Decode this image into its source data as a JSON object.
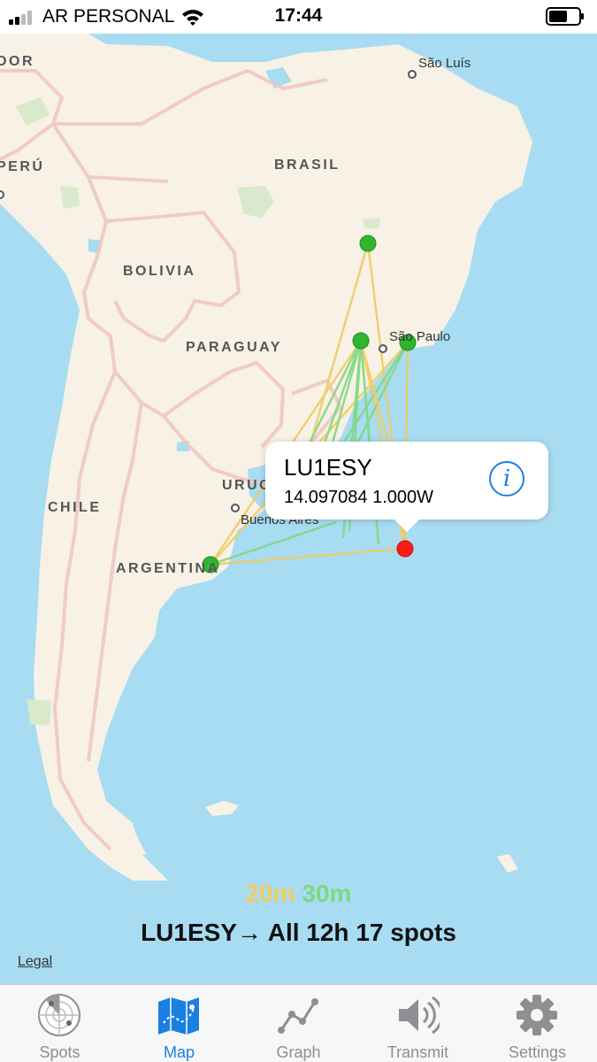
{
  "status_bar": {
    "carrier": "AR PERSONAL",
    "time": "17:44"
  },
  "map": {
    "country_labels": {
      "ecuador_partial": "DOR",
      "peru": "PERÚ",
      "brasil": "BRASIL",
      "bolivia": "BOLIVIA",
      "paraguay": "PARAGUAY",
      "uruguay_partial": "URUG",
      "chile": "CHILE",
      "argentina": "ARGENTINA"
    },
    "city_labels": {
      "sao_luis": "São Luís",
      "sao_paulo": "São Paulo",
      "buenos_aires": "Buenos Aires"
    },
    "spot_colors": {
      "receiver": "#2fb52f",
      "transmitter": "#ff1a1a",
      "band_20m": "#f0cc5e",
      "band_30m": "#7fd87f"
    },
    "callout": {
      "callsign": "LU1ESY",
      "detail": "14.097084 1.000W",
      "info_icon": "info-icon"
    },
    "legal": "Legal"
  },
  "legend": {
    "band_20m": "20m",
    "band_30m": "30m",
    "summary": "LU1ESY→ All 12h 17 spots"
  },
  "tabs": [
    {
      "label": "Spots",
      "icon": "radar-icon"
    },
    {
      "label": "Map",
      "icon": "map-icon"
    },
    {
      "label": "Graph",
      "icon": "graph-icon"
    },
    {
      "label": "Transmit",
      "icon": "speaker-icon"
    },
    {
      "label": "Settings",
      "icon": "gear-icon"
    }
  ],
  "active_tab": "Map"
}
